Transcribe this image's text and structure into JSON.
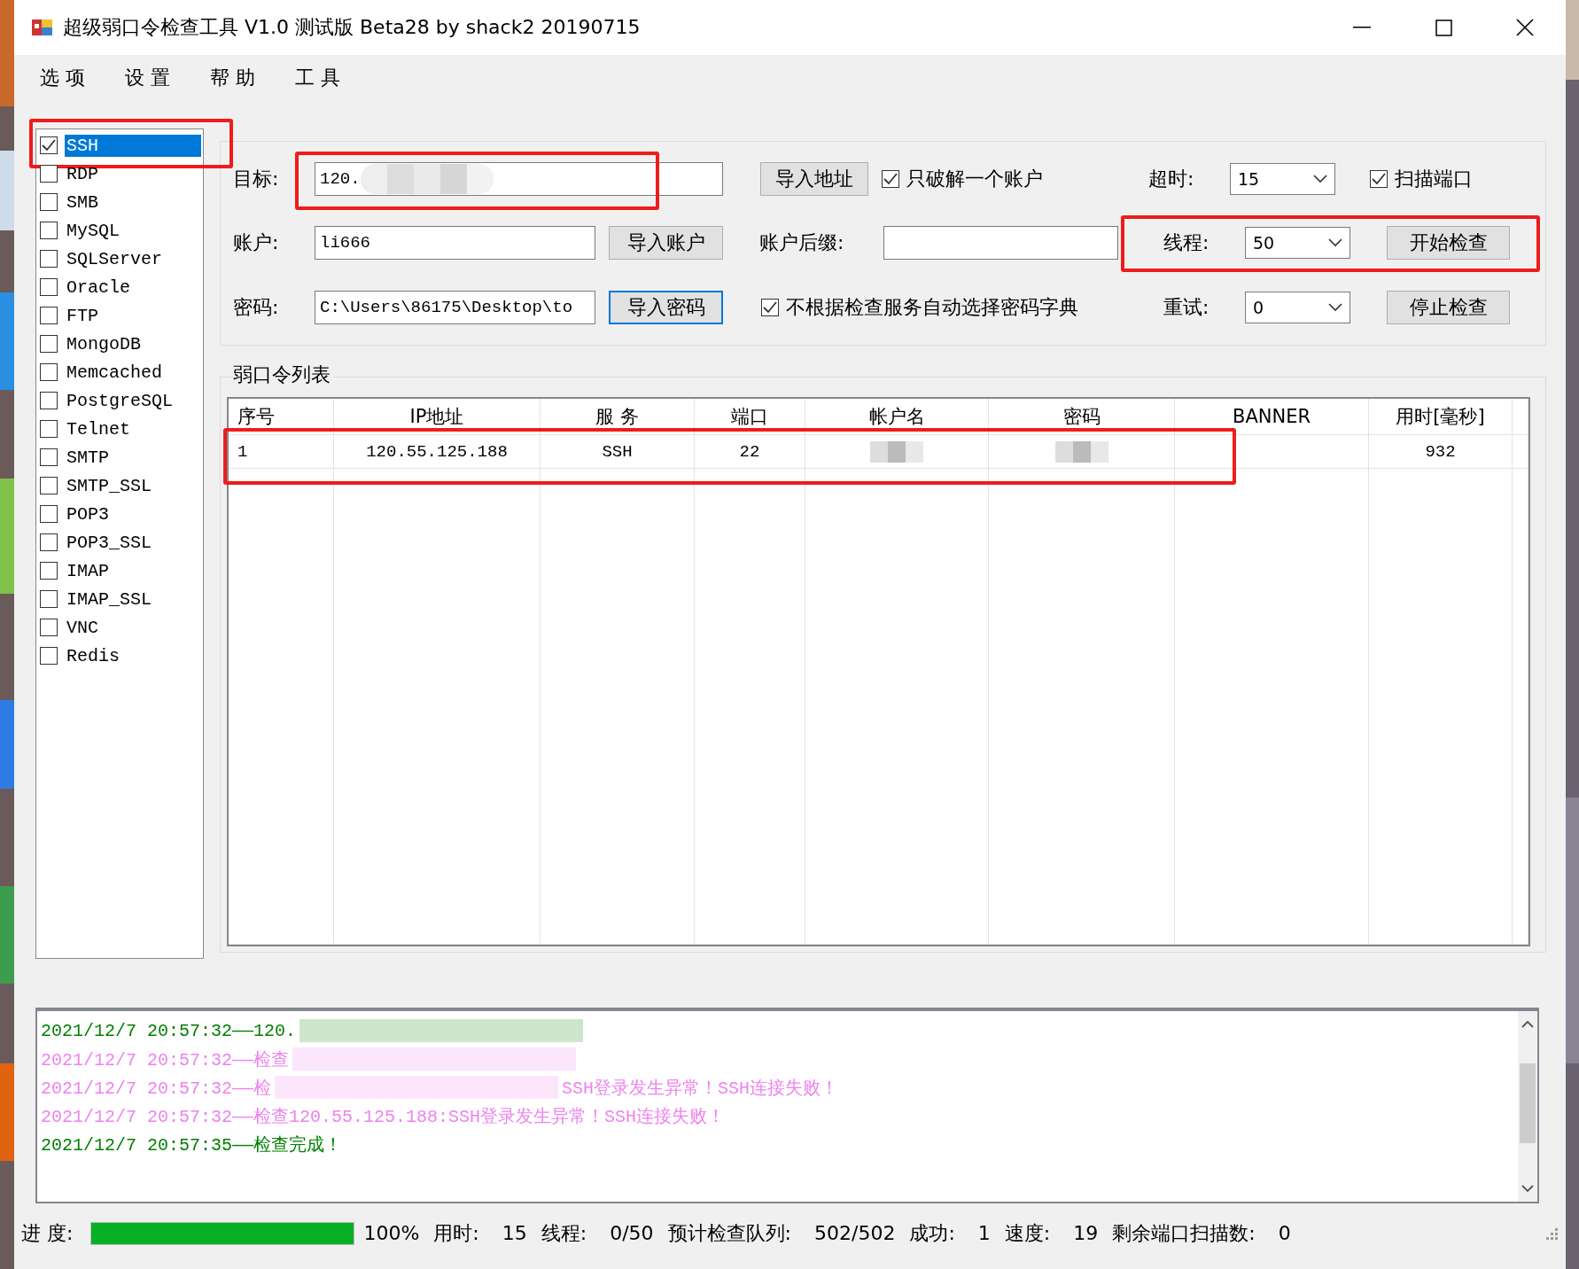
{
  "window": {
    "title": "超级弱口令检查工具 V1.0 测试版 Beta28 by shack2 20190715"
  },
  "menu": [
    "选 项",
    "设 置",
    "帮 助",
    "工 具"
  ],
  "services": [
    {
      "label": "SSH",
      "checked": true,
      "selected": true,
      "highlighted": true
    },
    {
      "label": "RDP",
      "checked": false,
      "selected": false,
      "highlighted": false
    },
    {
      "label": "SMB",
      "checked": false,
      "selected": false,
      "highlighted": false
    },
    {
      "label": "MySQL",
      "checked": false,
      "selected": false,
      "highlighted": false
    },
    {
      "label": "SQLServer",
      "checked": false,
      "selected": false,
      "highlighted": false
    },
    {
      "label": "Oracle",
      "checked": false,
      "selected": false,
      "highlighted": false
    },
    {
      "label": "FTP",
      "checked": false,
      "selected": false,
      "highlighted": false
    },
    {
      "label": "MongoDB",
      "checked": false,
      "selected": false,
      "highlighted": false
    },
    {
      "label": "Memcached",
      "checked": false,
      "selected": false,
      "highlighted": false
    },
    {
      "label": "PostgreSQL",
      "checked": false,
      "selected": false,
      "highlighted": false
    },
    {
      "label": "Telnet",
      "checked": false,
      "selected": false,
      "highlighted": false
    },
    {
      "label": "SMTP",
      "checked": false,
      "selected": false,
      "highlighted": false
    },
    {
      "label": "SMTP_SSL",
      "checked": false,
      "selected": false,
      "highlighted": false
    },
    {
      "label": "POP3",
      "checked": false,
      "selected": false,
      "highlighted": false
    },
    {
      "label": "POP3_SSL",
      "checked": false,
      "selected": false,
      "highlighted": false
    },
    {
      "label": "IMAP",
      "checked": false,
      "selected": false,
      "highlighted": false
    },
    {
      "label": "IMAP_SSL",
      "checked": false,
      "selected": false,
      "highlighted": false
    },
    {
      "label": "VNC",
      "checked": false,
      "selected": false,
      "highlighted": false
    },
    {
      "label": "Redis",
      "checked": false,
      "selected": false,
      "highlighted": false
    }
  ],
  "settings": {
    "target": {
      "label": "目标:",
      "value": "120.",
      "redacted": true,
      "highlighted": true
    },
    "import_address": {
      "label": "导入地址"
    },
    "single_account": {
      "label": "只破解一个账户",
      "checked": true
    },
    "timeout": {
      "label": "超时:",
      "value": "15"
    },
    "scan_ports": {
      "label": "扫描端口",
      "checked": true
    },
    "account": {
      "label": "账户:",
      "value": "li666"
    },
    "import_account": {
      "label": "导入账户"
    },
    "account_suffix": {
      "label": "账户后缀:"
    },
    "threads": {
      "label": "线程:",
      "value": "50",
      "highlighted": true
    },
    "start": {
      "label": "开始检查"
    },
    "password": {
      "label": "密码:",
      "value": "C:\\Users\\86175\\Desktop\\to"
    },
    "import_password": {
      "label": "导入密码",
      "focused": true
    },
    "auto_dict": {
      "label": "不根据检查服务自动选择密码字典",
      "checked": true
    },
    "retry": {
      "label": "重试:",
      "value": "0"
    },
    "stop": {
      "label": "停止检查"
    }
  },
  "results": {
    "title": "弱口令列表",
    "columns": [
      "序号",
      "IP地址",
      "服 务",
      "端口",
      "帐户名",
      "密码",
      "BANNER",
      "用时[毫秒]"
    ],
    "rows": [
      {
        "cells": [
          "1",
          "120.55.125.188",
          "SSH",
          "22",
          null,
          null,
          null,
          "932"
        ],
        "redacted": true,
        "highlighted": true
      }
    ]
  },
  "log": [
    {
      "parts": [
        "2021/12/7 20:57:32——120."
      ],
      "color": "#008000",
      "redacted": true
    },
    {
      "parts": [
        "2021/12/7 20:57:32——检查"
      ],
      "color": "#ee82ee",
      "redacted": true
    },
    {
      "parts": [
        "2021/12/7 20:57:32——检",
        "SSH登录发生异常！SSH连接失败！"
      ],
      "color": "#ee82ee",
      "redacted": true
    },
    {
      "parts": [
        "2021/12/7 20:57:32——检查120.55.125.188:SSH登录发生异常！SSH连接失败！"
      ],
      "color": "#ee82ee",
      "redacted": false
    },
    {
      "parts": [
        "2021/12/7 20:57:35——检查完成！"
      ],
      "color": "#008000",
      "redacted": false
    }
  ],
  "status_bar": {
    "progress_label": "进 度:",
    "level": 1,
    "percent": "100%",
    "stats": [
      {
        "label": "用时:",
        "value": "15"
      },
      {
        "label": "线程:",
        "value": "0/50"
      },
      {
        "label": "预计检查队列:",
        "value": "502/502"
      },
      {
        "label": "成功:",
        "value": "1"
      },
      {
        "label": "速度:",
        "value": "19"
      },
      {
        "label": "剩余端口扫描数:",
        "value": "0"
      }
    ]
  }
}
